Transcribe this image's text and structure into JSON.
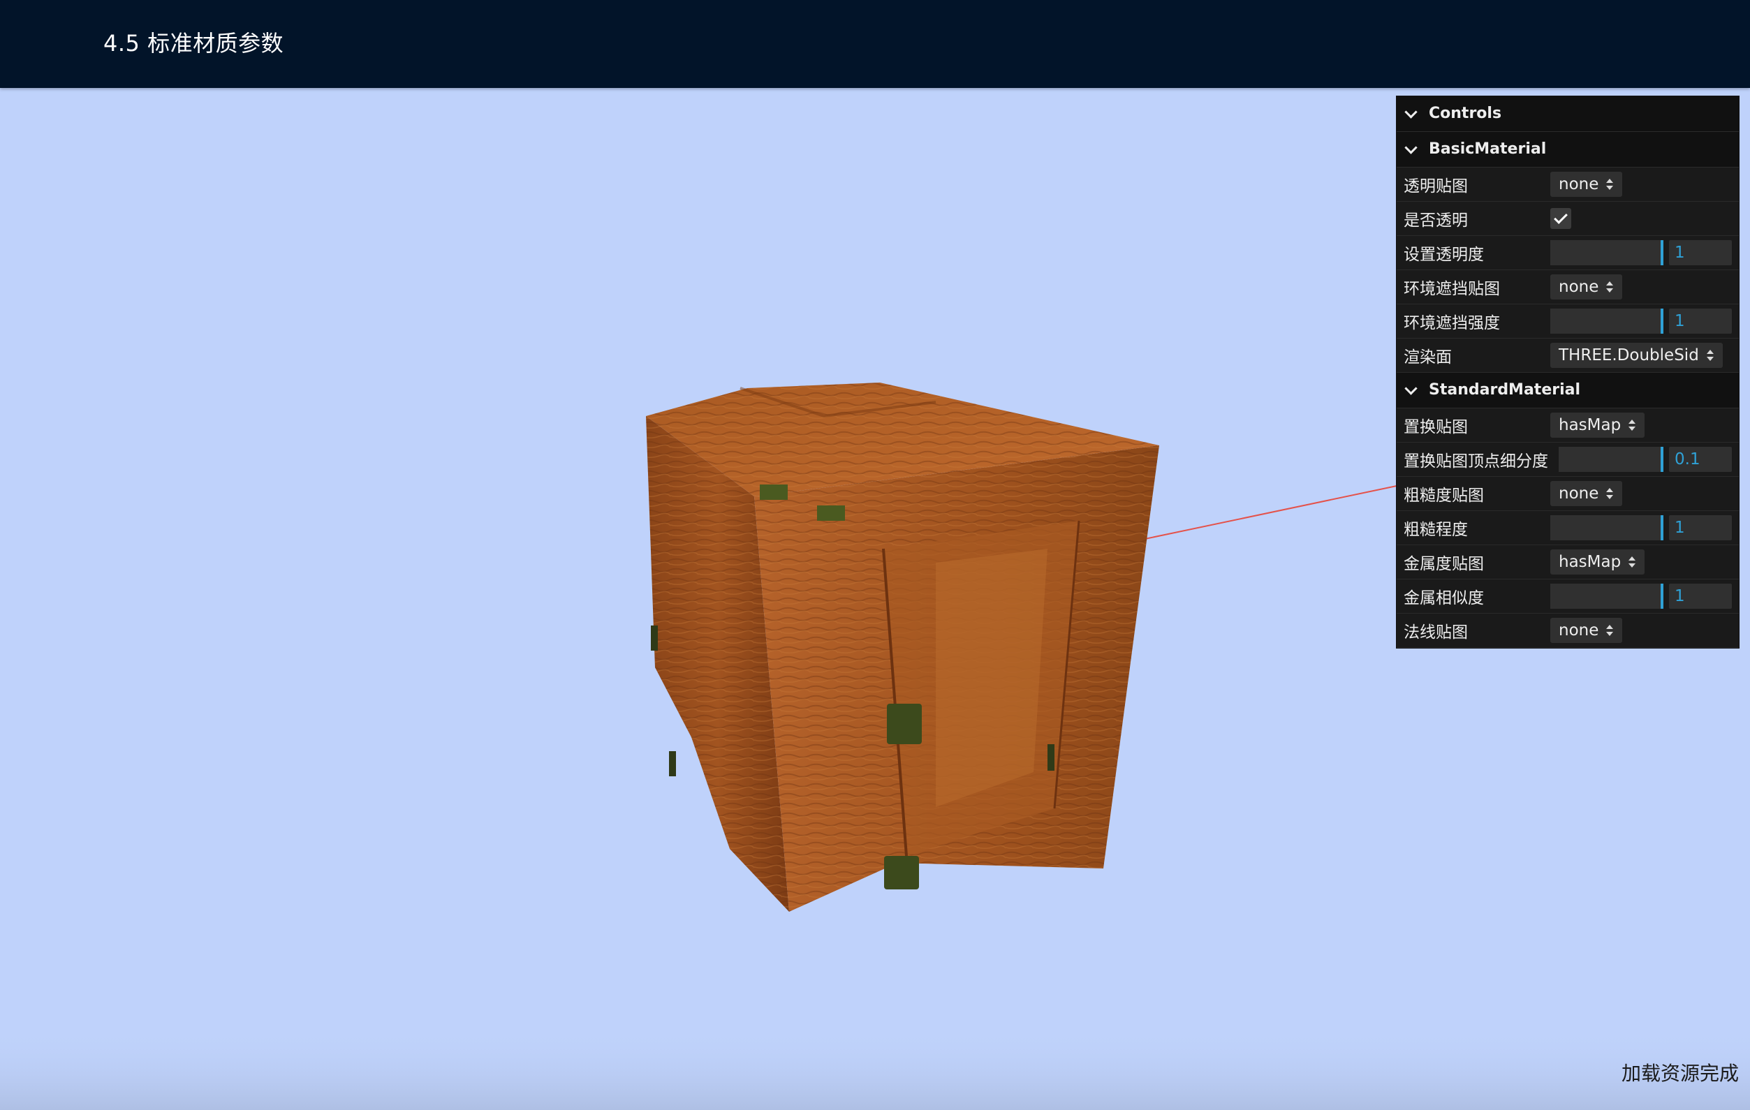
{
  "header": {
    "title": "4.5 标准材质参数"
  },
  "status": {
    "text": "加载资源完成"
  },
  "colors": {
    "header_bg": "#021429",
    "scene_bg": "#bfd2fb",
    "panel_bg": "#1a1a1a",
    "accent": "#2fa1d6",
    "wood": "#a0521f"
  },
  "gui": {
    "title": "Controls",
    "basic": {
      "title": "BasicMaterial",
      "alpha_map": {
        "label": "透明贴图",
        "value": "none"
      },
      "transparent": {
        "label": "是否透明",
        "checked": true
      },
      "opacity": {
        "label": "设置透明度",
        "value": "1",
        "fraction": 1.0
      },
      "ao_map": {
        "label": "环境遮挡贴图",
        "value": "none"
      },
      "ao_intensity": {
        "label": "环境遮挡强度",
        "value": "1",
        "fraction": 1.0
      },
      "side": {
        "label": "渲染面",
        "value": "THREE.DoubleSid"
      }
    },
    "standard": {
      "title": "StandardMaterial",
      "displacement_map": {
        "label": "置换贴图",
        "value": "hasMap"
      },
      "displacement_scale": {
        "label": "置换贴图顶点细分度",
        "value": "0.1",
        "fraction": 1.0
      },
      "roughness_map": {
        "label": "粗糙度贴图",
        "value": "none"
      },
      "roughness": {
        "label": "粗糙程度",
        "value": "1",
        "fraction": 1.0
      },
      "metalness_map": {
        "label": "金属度贴图",
        "value": "hasMap"
      },
      "metalness": {
        "label": "金属相似度",
        "value": "1",
        "fraction": 1.0
      },
      "normal_map": {
        "label": "法线贴图",
        "value": "none"
      }
    }
  }
}
